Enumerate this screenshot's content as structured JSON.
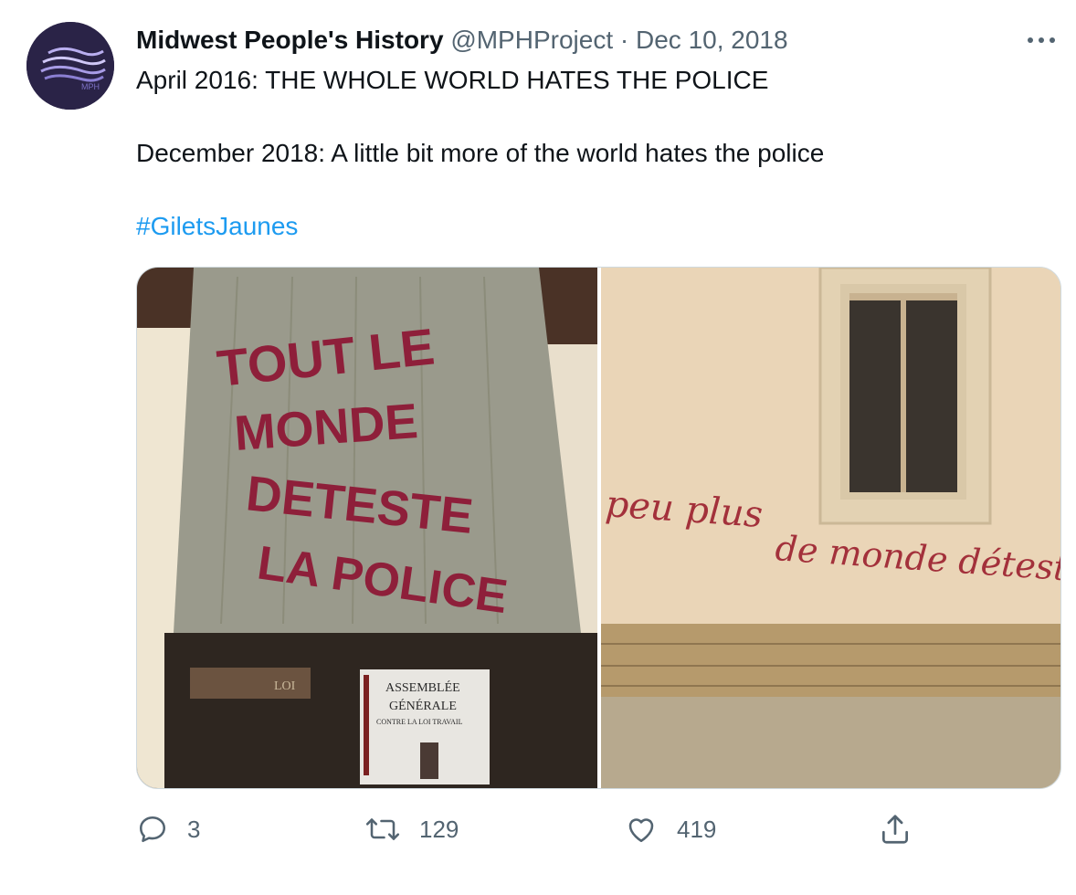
{
  "tweet": {
    "author_name": "Midwest People's History",
    "handle": "@MPHProject",
    "separator": "·",
    "date": "Dec 10, 2018",
    "avatar_text": "MPH",
    "text_line1": "April 2016: THE WHOLE WORLD HATES THE POLICE",
    "text_line2": "December 2018: A little bit more of the world hates the police",
    "hashtag": "#GiletsJaunes"
  },
  "media": {
    "left": {
      "graffiti_lines": [
        "TOUT LE",
        "MONDE",
        "DETESTE",
        "LA POLICE"
      ],
      "poster_lines": [
        "ASSEMBLÉE",
        "GÉNÉRALE",
        "CONTRE LA LOI TRAVAIL"
      ],
      "plaque_text": "LOI"
    },
    "right": {
      "graffiti_lines": [
        "peu plus",
        "de monde détest"
      ]
    }
  },
  "actions": {
    "reply_count": "3",
    "retweet_count": "129",
    "like_count": "419"
  },
  "colors": {
    "link": "#1d9bf0",
    "secondary_text": "#536471",
    "avatar_bg": "#2a2347",
    "graffiti_red": "#8e1f3a"
  }
}
